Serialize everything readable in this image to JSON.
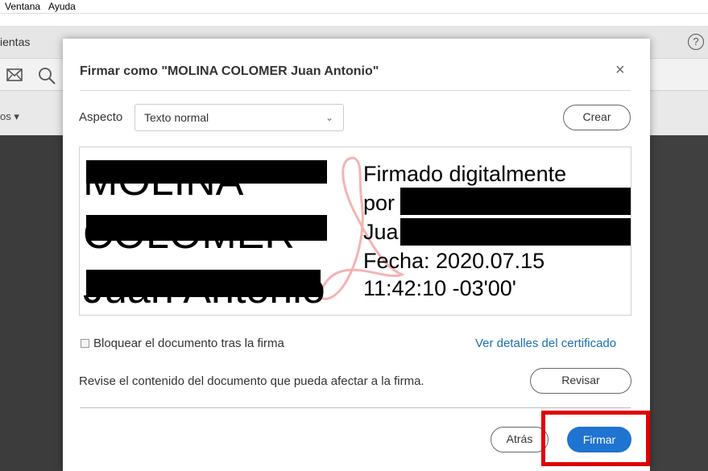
{
  "menubar": {
    "items": [
      "Ventana",
      "Ayuda"
    ]
  },
  "app": {
    "tab_text": "ientas",
    "tools_text": "os ▾",
    "help_icon_glyph": "?"
  },
  "dialog": {
    "title": "Firmar como \"MOLINA COLOMER Juan Antonio\"",
    "close_glyph": "×",
    "aspect_label": "Aspecto",
    "aspect_value": "Texto normal",
    "aspect_chevron": "⌄",
    "create_label": "Crear",
    "preview": {
      "name_lines": [
        "MOLINA",
        "COLOMER",
        "Juan Antonio"
      ],
      "right_lines": [
        "Firmado digitalmente",
        "por",
        "Jua",
        "Fecha: 2020.07.15",
        "11:42:10 -03'00'"
      ]
    },
    "lock_label": "Bloquear el documento tras la firma",
    "cert_link": "Ver detalles del certificado",
    "review_text": "Revise el contenido del documento que pueda afectar a la firma.",
    "review_button": "Revisar",
    "back_button": "Atrás",
    "sign_button": "Firmar"
  },
  "colors": {
    "accent": "#1f73d1",
    "link": "#1a6fb5",
    "highlight": "#e00000",
    "app_background": "#404040"
  }
}
